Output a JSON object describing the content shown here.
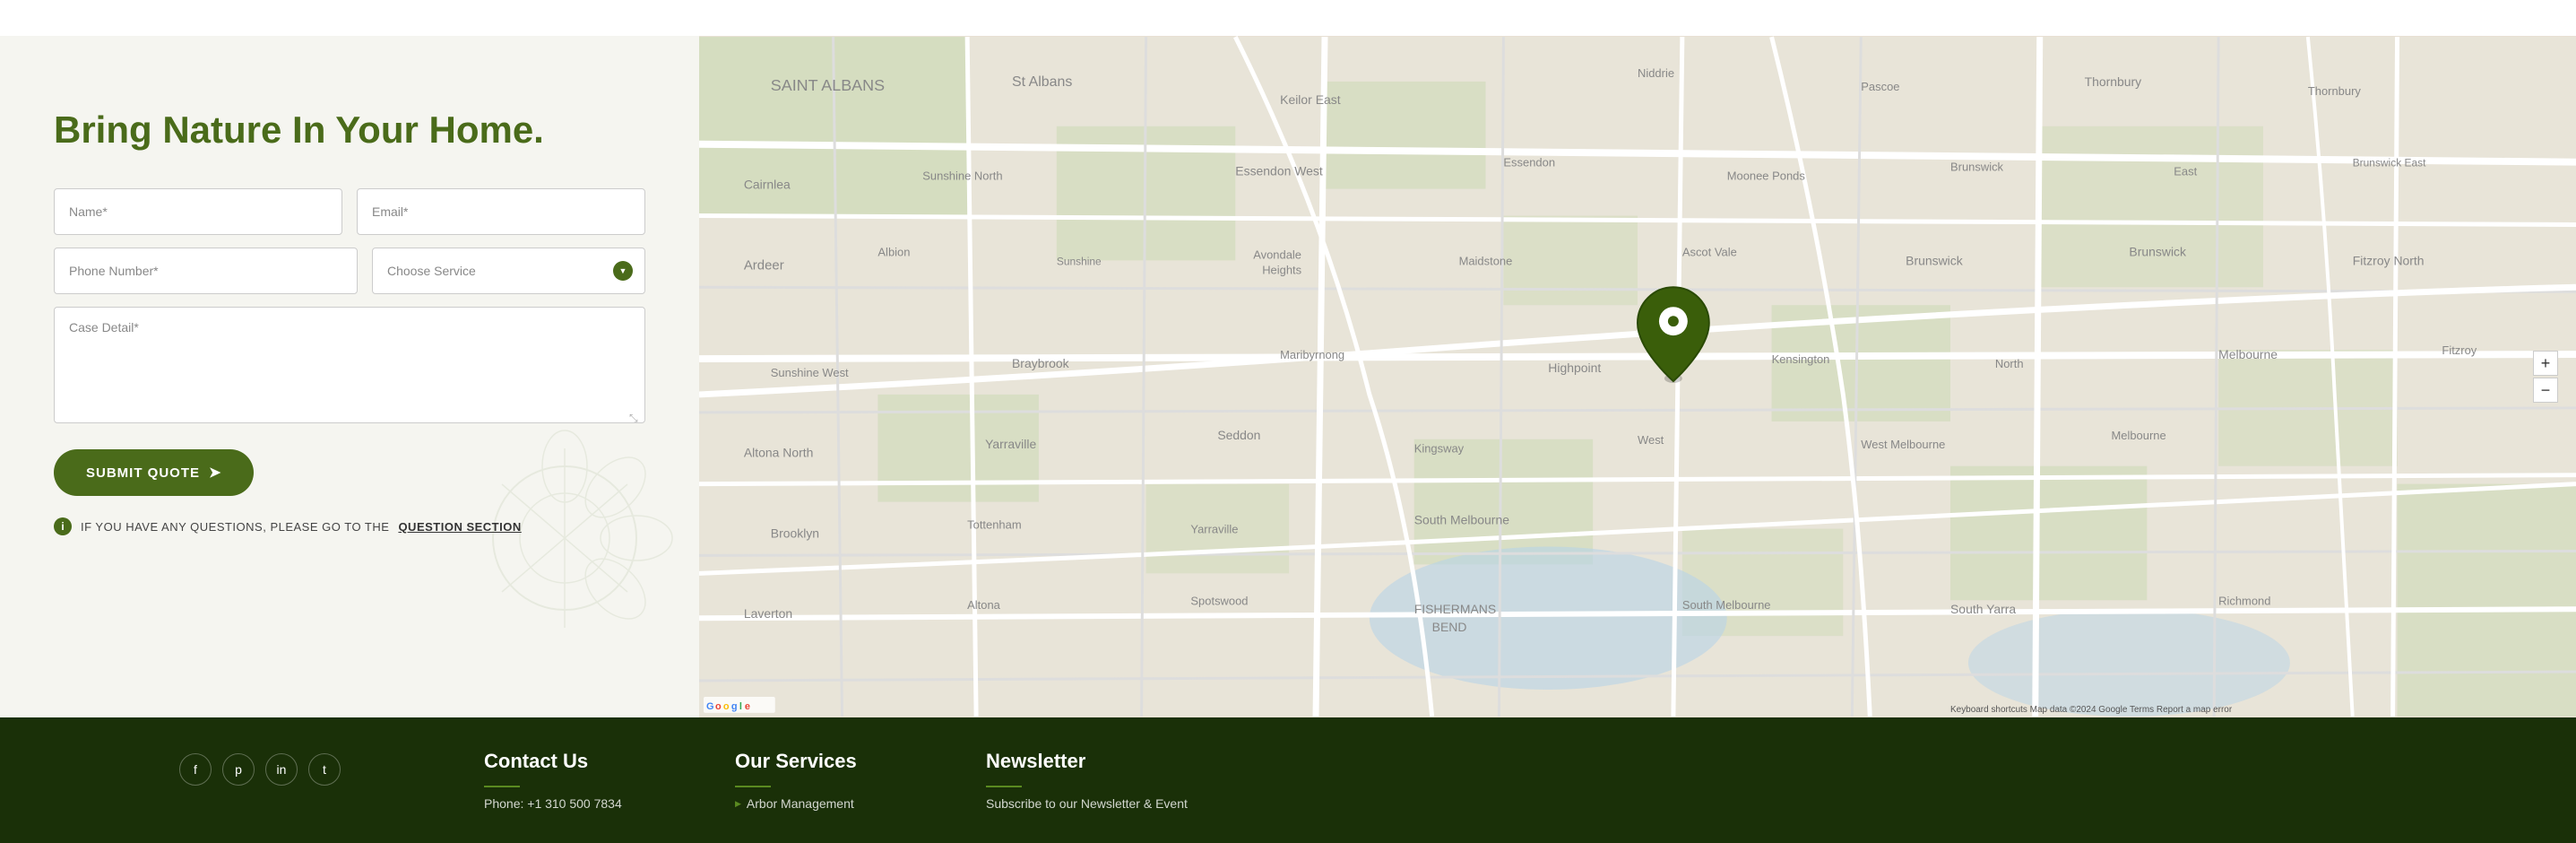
{
  "topbar": {},
  "form": {
    "title_part1": "Bring Nature In",
    "title_part2": " Your Home.",
    "name_placeholder": "Name*",
    "email_placeholder": "Email*",
    "phone_placeholder": "Phone Number*",
    "service_placeholder": "Choose Service",
    "case_placeholder": "Case Detail*",
    "submit_label": "SUBMIT QUOTE",
    "notice_text": "IF YOU HAVE ANY QUESTIONS, PLEASE GO TO THE",
    "notice_link": "QUESTION SECTION"
  },
  "map": {
    "zoom_in": "+",
    "zoom_out": "−",
    "attribution": "Keyboard shortcuts  Map data ©2024 Google  Terms  Report a map error"
  },
  "footer": {
    "contact_title": "Contact Us",
    "services_title": "Our Services",
    "newsletter_title": "Newsletter",
    "contact_phone": "Phone: +1 310 500 7834",
    "services_item1": "Arbor Management",
    "newsletter_text": "Subscribe to our Newsletter & Event",
    "social_icons": [
      "f",
      "p",
      "in",
      "t"
    ]
  }
}
